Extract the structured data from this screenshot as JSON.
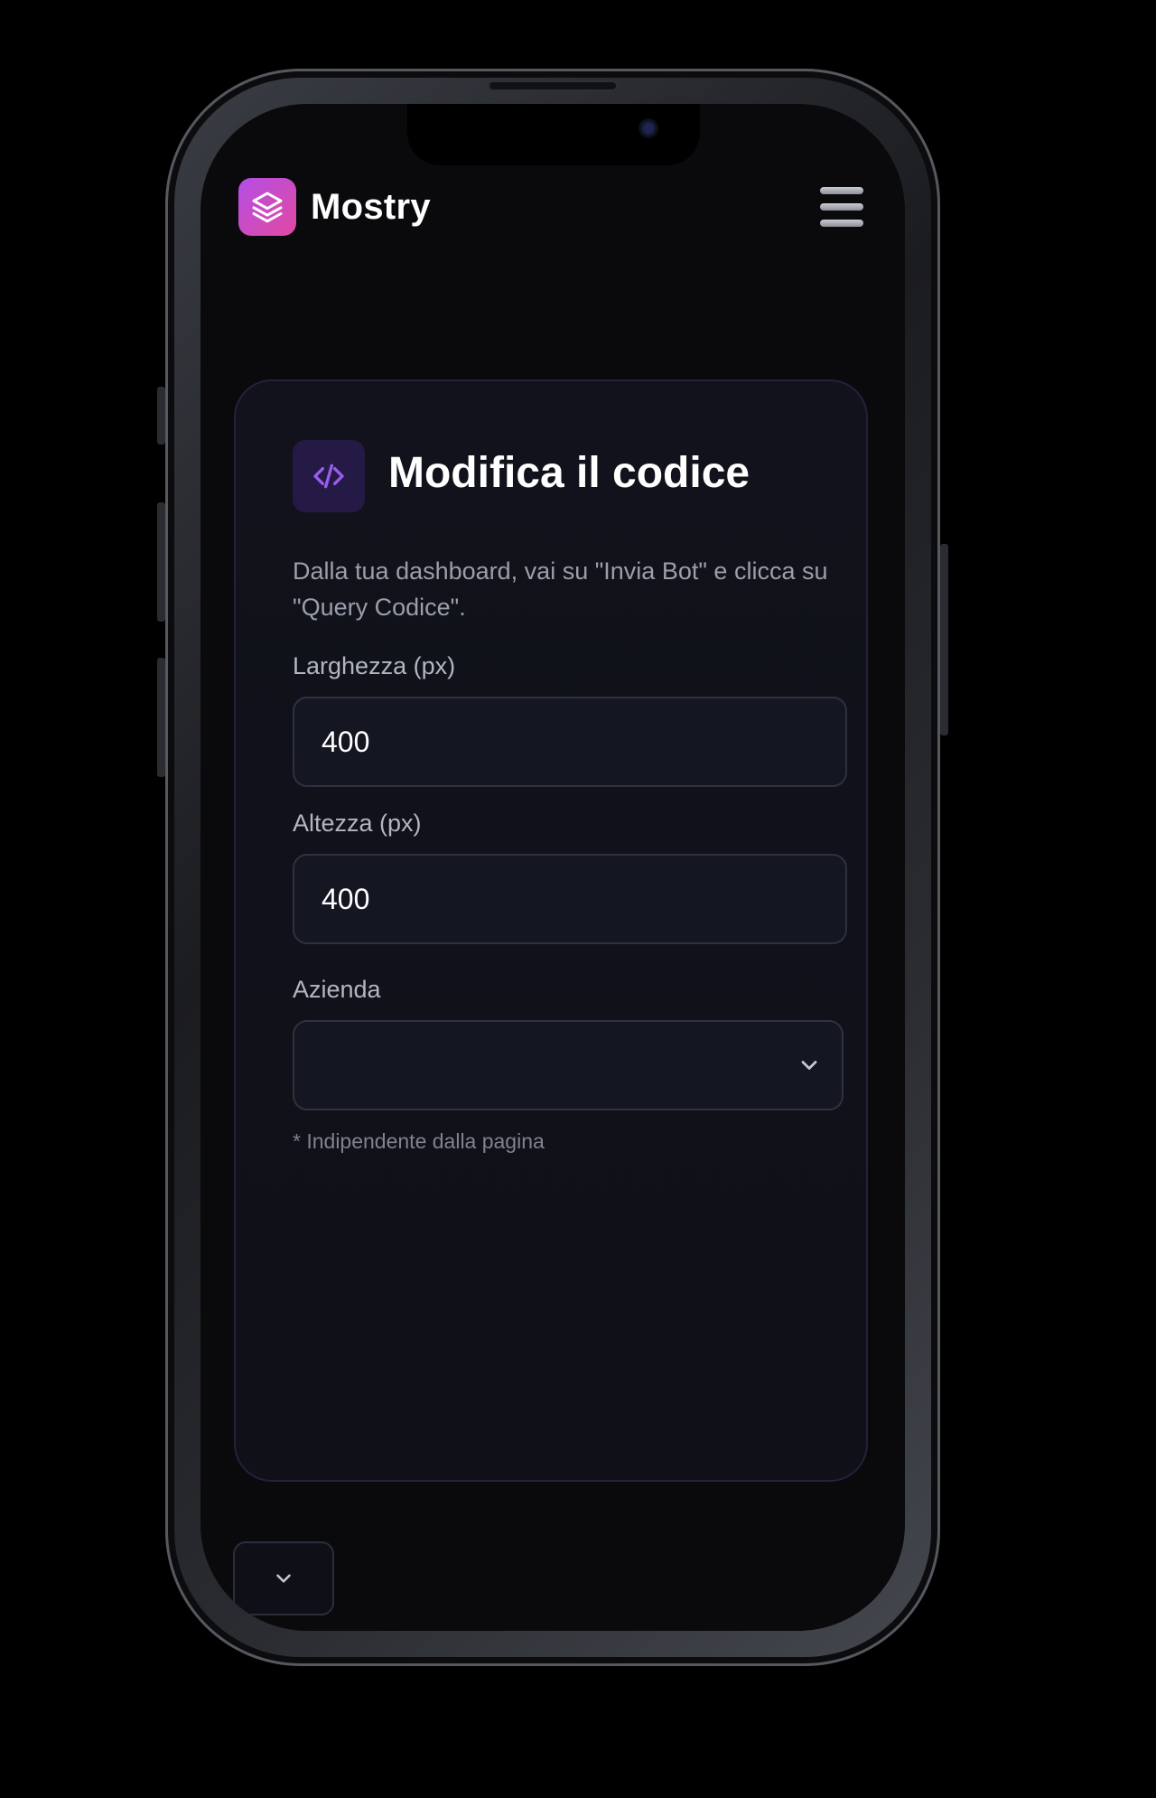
{
  "app": {
    "brand_name": "Mostry",
    "brand_icon": "layers-icon",
    "menu_icon": "hamburger-menu-icon"
  },
  "card": {
    "icon": "code-icon",
    "title": "Modifica il codice",
    "description": "Dalla tua dashboard, vai su \"Invia Bot\" e clicca su \"Query Codice\".",
    "fields": {
      "width": {
        "label": "Larghezza (px)",
        "value": "400"
      },
      "height": {
        "label": "Altezza (px)",
        "value": "400"
      },
      "company": {
        "label": "Azienda",
        "value": ""
      }
    },
    "hint": "* Indipendente dalla pagina"
  },
  "scroll_button": {
    "icon": "chevron-down-icon"
  },
  "colors": {
    "brand_gradient_start": "#b44ee6",
    "brand_gradient_end": "#e14aa0",
    "accent_purple": "#9b5cf0",
    "background": "#0a0a0d"
  }
}
